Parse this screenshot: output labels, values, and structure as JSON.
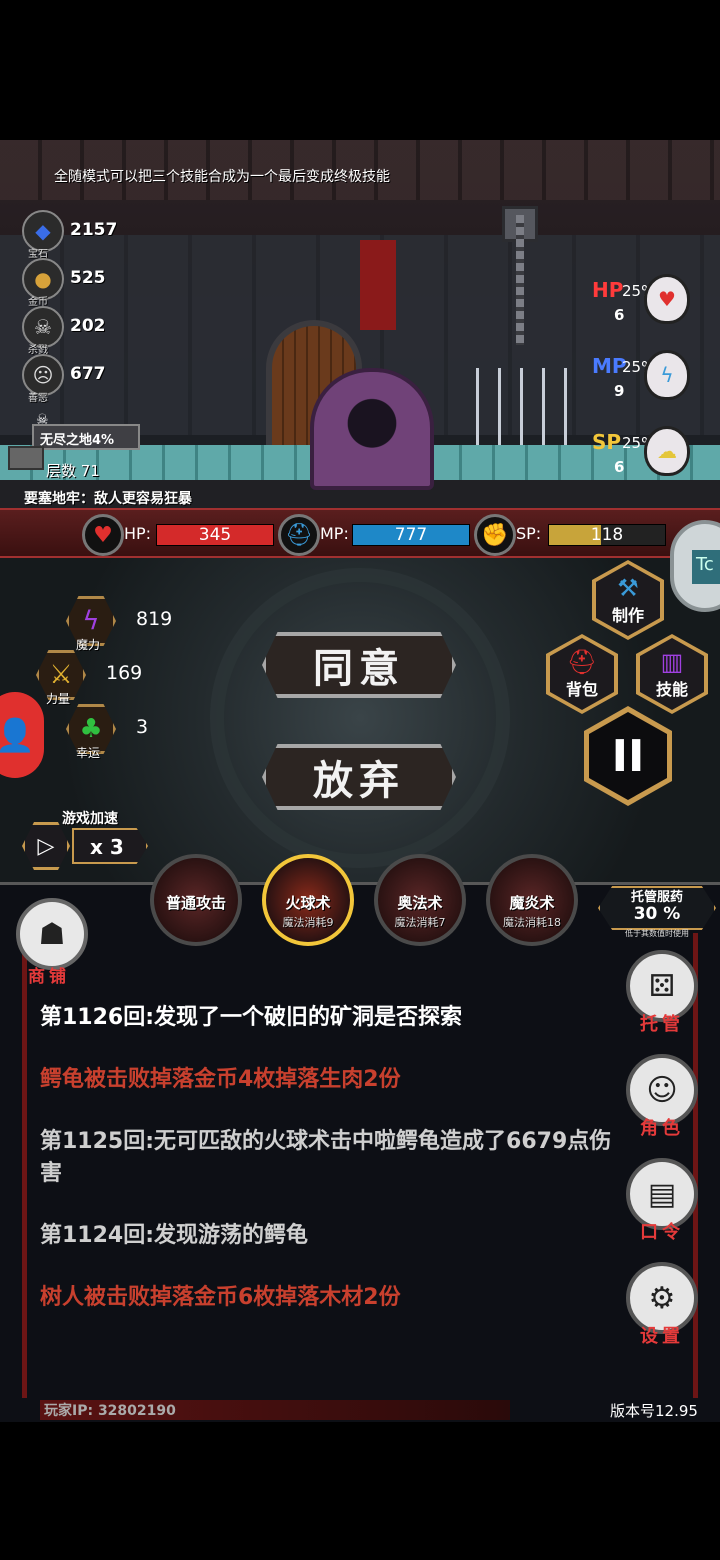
{
  "hint": "全随模式可以把三个技能合成为一个最后变成终极技能",
  "resources": [
    {
      "icon": "gem-icon",
      "glyph": "◆",
      "color": "#3a6de8",
      "caption": "宝石",
      "value": "2157"
    },
    {
      "icon": "coin-icon",
      "glyph": "●",
      "color": "#d7a23a",
      "caption": "金币",
      "value": "525"
    },
    {
      "icon": "skull-icon",
      "glyph": "☠",
      "color": "#dcdcdc",
      "caption": "杀戮",
      "value": "202"
    },
    {
      "icon": "mask-icon",
      "glyph": "☹",
      "color": "#dcdcdc",
      "caption": "善恶",
      "value": "677"
    }
  ],
  "endless": {
    "title": "无尽之地4%",
    "layer": "层数 71"
  },
  "fortress": "要塞地牢：敌人更容易狂暴",
  "potions": [
    {
      "label": "HP",
      "label_color": "#ff3b3b",
      "percent": "25%",
      "count": "6",
      "icon": "hp-potion-icon",
      "glyph": "♥"
    },
    {
      "label": "MP",
      "label_color": "#4a7bff",
      "percent": "25%",
      "count": "9",
      "icon": "mp-potion-icon",
      "glyph": "ϟ"
    },
    {
      "label": "SP",
      "label_color": "#f2c63a",
      "percent": "25%",
      "count": "6",
      "icon": "sp-potion-icon",
      "glyph": "☁"
    }
  ],
  "stats": [
    {
      "name": "HP:",
      "value": "345",
      "color": "#d42a2a",
      "icon": "heart-icon",
      "glyph": "♥",
      "glyph_color": "#e0302e"
    },
    {
      "name": "MP:",
      "value": "777",
      "color": "#1e88c8",
      "icon": "helmet-icon",
      "glyph": "⛑",
      "glyph_color": "#3a9ad8"
    },
    {
      "name": "SP:",
      "value": "118",
      "color": "#c8a43a",
      "icon": "strongman-icon",
      "glyph": "✊",
      "glyph_color": "#e4c63a"
    }
  ],
  "attributes": [
    {
      "icon": "magic-icon",
      "glyph": "ϟ",
      "color": "#a040e0",
      "caption": "魔力",
      "value": "819"
    },
    {
      "icon": "sword-icon",
      "glyph": "⚔",
      "color": "#e0b030",
      "caption": "力量",
      "value": "169"
    },
    {
      "icon": "clover-icon",
      "glyph": "♣",
      "color": "#30c040",
      "caption": "幸运",
      "value": "3"
    }
  ],
  "buttons": {
    "agree": "同意",
    "abandon": "放弃",
    "craft": "制作",
    "bag": "背包",
    "skills": "技能",
    "pause": "II"
  },
  "speed": {
    "title": "游戏加速",
    "multiplier": "x 3"
  },
  "skill_slots": [
    {
      "name": "普通攻击",
      "cost": ""
    },
    {
      "name": "火球术",
      "cost": "魔法消耗9"
    },
    {
      "name": "奥法术",
      "cost": "魔法消耗7"
    },
    {
      "name": "魔炎术",
      "cost": "魔法消耗18"
    }
  ],
  "auto_potion": {
    "title": "托管服药",
    "percent": "30 %",
    "sub": "低于其数值时使用"
  },
  "shop": "商铺",
  "side_buttons": [
    {
      "label": "托管",
      "icon": "dice-icon",
      "glyph": "⚄"
    },
    {
      "label": "角色",
      "icon": "hood-icon",
      "glyph": "☺"
    },
    {
      "label": "口令",
      "icon": "book-icon",
      "glyph": "▤"
    },
    {
      "label": "设置",
      "icon": "gear-icon",
      "glyph": "⚙"
    }
  ],
  "log": [
    {
      "text": "第1126回:发现了一个破旧的矿洞是否探索",
      "style": "white"
    },
    {
      "text": "鳄龟被击败掉落金币4枚掉落生肉2份",
      "style": "red"
    },
    {
      "text": "第1125回:无可匹敌的火球术击中啦鳄龟造成了6679点伤害",
      "style": "gray"
    },
    {
      "text": "第1124回:发现游荡的鳄龟",
      "style": "gray"
    },
    {
      "text": "树人被击败掉落金币6枚掉落木材2份",
      "style": "red"
    }
  ],
  "footer": {
    "ip": "玩家IP:  32802190",
    "version": "版本号12.95"
  }
}
